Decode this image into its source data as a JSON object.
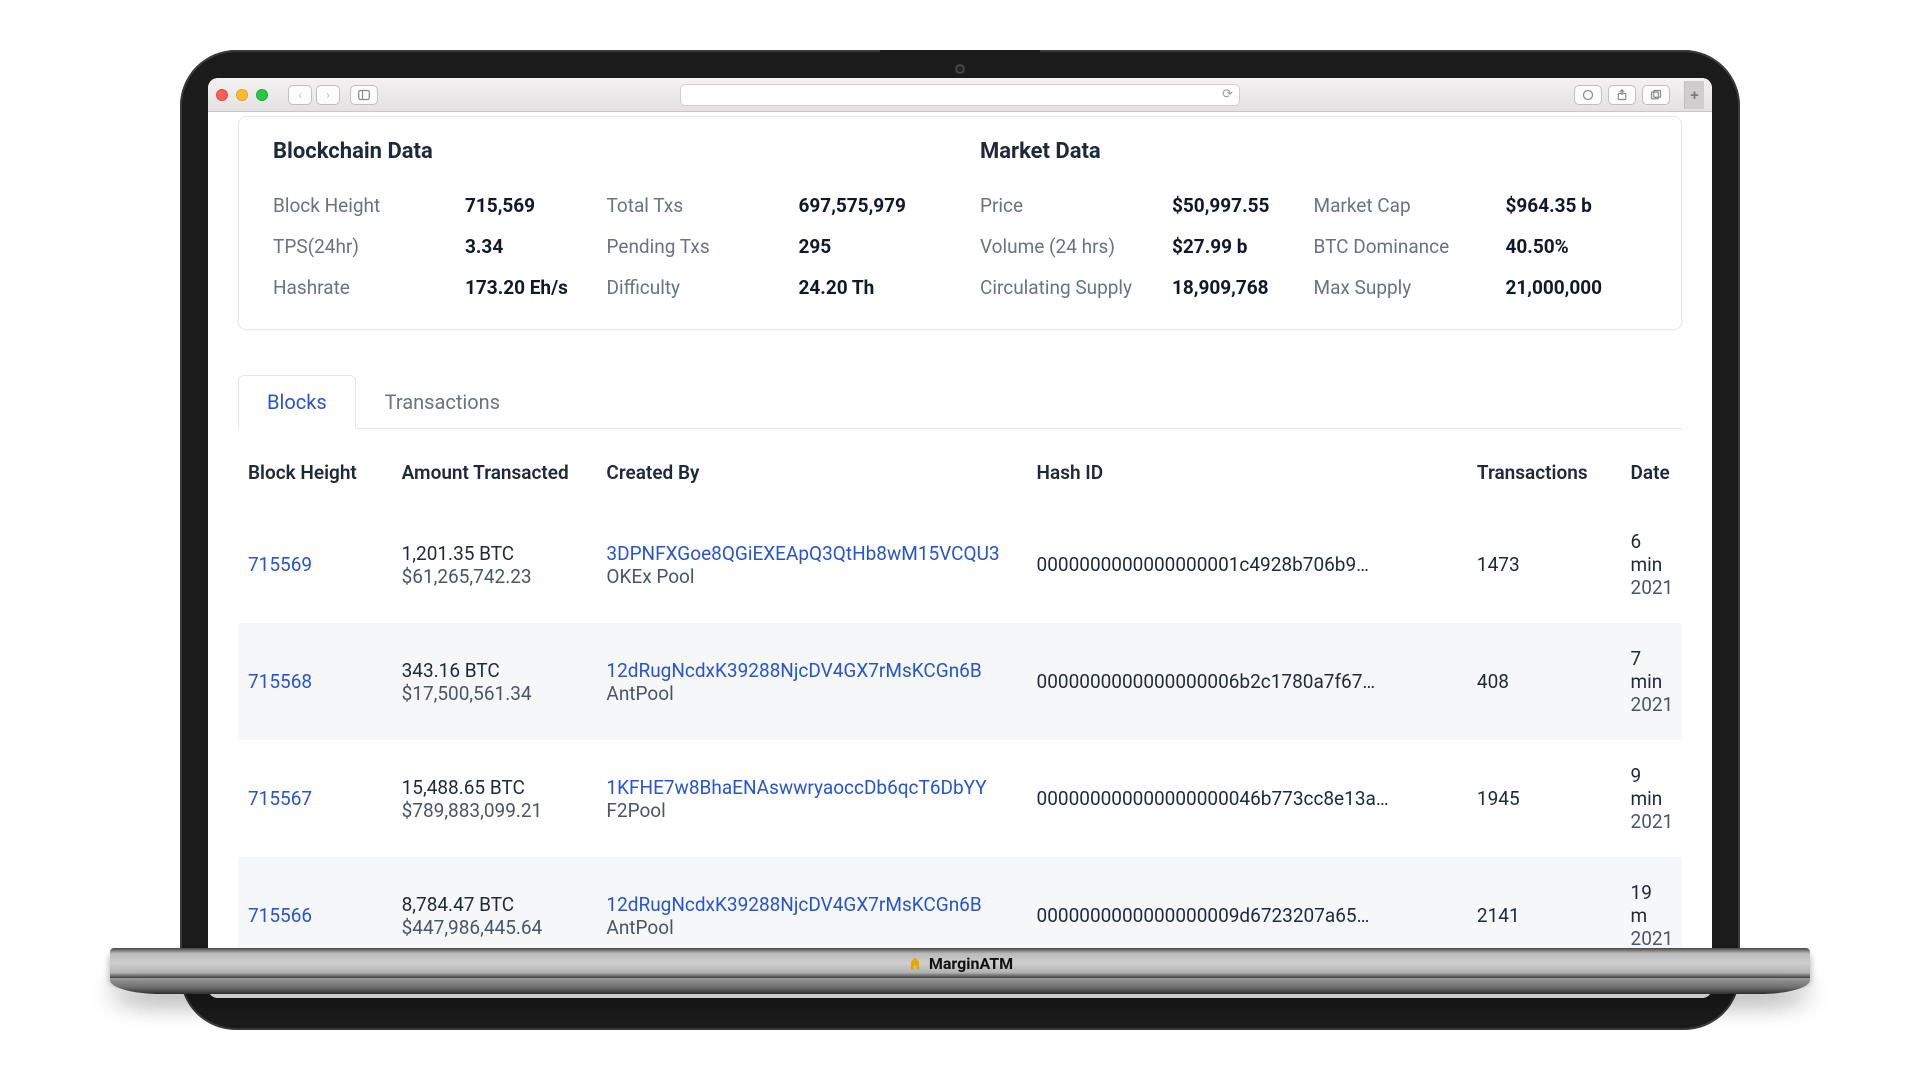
{
  "brand": "MarginATM",
  "blockchain": {
    "title": "Blockchain Data",
    "metrics": [
      {
        "label": "Block Height",
        "value": "715,569"
      },
      {
        "label": "Total Txs",
        "value": "697,575,979"
      },
      {
        "label": "TPS(24hr)",
        "value": "3.34"
      },
      {
        "label": "Pending Txs",
        "value": "295"
      },
      {
        "label": "Hashrate",
        "value": "173.20 Eh/s"
      },
      {
        "label": "Difficulty",
        "value": "24.20 Th"
      }
    ]
  },
  "market": {
    "title": "Market Data",
    "metrics": [
      {
        "label": "Price",
        "value": "$50,997.55"
      },
      {
        "label": "Market Cap",
        "value": "$964.35 b"
      },
      {
        "label": "Volume (24 hrs)",
        "value": "$27.99 b"
      },
      {
        "label": "BTC Dominance",
        "value": "40.50%"
      },
      {
        "label": "Circulating Supply",
        "value": "18,909,768"
      },
      {
        "label": "Max Supply",
        "value": "21,000,000"
      }
    ]
  },
  "tabs": {
    "blocks": "Blocks",
    "transactions": "Transactions",
    "active": "blocks"
  },
  "table": {
    "columns": {
      "height": "Block Height",
      "amount": "Amount Transacted",
      "creator": "Created By",
      "hash": "Hash ID",
      "txs": "Transactions",
      "date": "Date"
    },
    "rows": [
      {
        "height": "715569",
        "amount_btc": "1,201.35 BTC",
        "amount_usd": "$61,265,742.23",
        "creator_addr": "3DPNFXGoe8QGiEXEApQ3QtHb8wM15VCQU3",
        "creator_name": "OKEx Pool",
        "hash": "0000000000000000001c4928b706b9…",
        "txs": "1473",
        "date_rel": "6 min",
        "date_year": "2021"
      },
      {
        "height": "715568",
        "amount_btc": "343.16 BTC",
        "amount_usd": "$17,500,561.34",
        "creator_addr": "12dRugNcdxK39288NjcDV4GX7rMsKCGn6B",
        "creator_name": "AntPool",
        "hash": "0000000000000000006b2c1780a7f67…",
        "txs": "408",
        "date_rel": "7 min",
        "date_year": "2021"
      },
      {
        "height": "715567",
        "amount_btc": "15,488.65 BTC",
        "amount_usd": "$789,883,099.21",
        "creator_addr": "1KFHE7w8BhaENAswwryaoccDb6qcT6DbYY",
        "creator_name": "F2Pool",
        "hash": "000000000000000000046b773cc8e13a…",
        "txs": "1945",
        "date_rel": "9 min",
        "date_year": "2021"
      },
      {
        "height": "715566",
        "amount_btc": "8,784.47 BTC",
        "amount_usd": "$447,986,445.64",
        "creator_addr": "12dRugNcdxK39288NjcDV4GX7rMsKCGn6B",
        "creator_name": "AntPool",
        "hash": "0000000000000000009d6723207a65…",
        "txs": "2141",
        "date_rel": "19 m",
        "date_year": "2021"
      }
    ]
  }
}
